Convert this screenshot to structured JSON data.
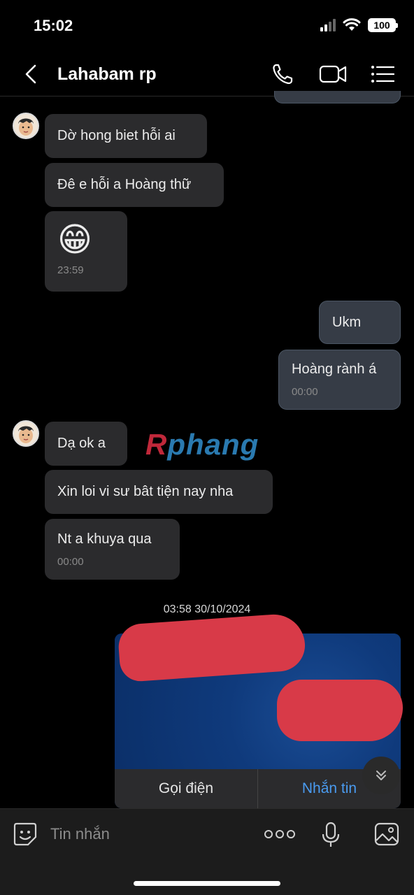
{
  "status": {
    "time": "15:02",
    "battery": "100"
  },
  "header": {
    "title": "Lahabam rp"
  },
  "messages": {
    "m1": "Dờ hong biet hỗi ai",
    "m2": "Đê e hỗi a Hoàng thữ",
    "m3_emoji": "😁",
    "m3_time": "23:59",
    "m4": "Ukm",
    "m5": "Hoàng rành á",
    "m5_time": "00:00",
    "m6": "Dạ ok a",
    "m7": "Xin loi vi sư bât tiện nay nha",
    "m8": "Nt a khuya qua",
    "m8_time": "00:00"
  },
  "watermark": {
    "r": "R",
    "rest": "phang"
  },
  "date_separator": "03:58 30/10/2024",
  "card": {
    "call_label": "Gọi điện",
    "message_label": "Nhắn tin"
  },
  "input": {
    "placeholder": "Tin nhắn"
  },
  "icons": {
    "back": "chevron-left-icon",
    "call": "phone-icon",
    "video": "video-camera-icon",
    "menu": "list-menu-icon",
    "sticker": "sticker-smile-icon",
    "more": "more-dots-icon",
    "mic": "microphone-icon",
    "image": "image-icon",
    "scroll": "double-chevron-down-icon"
  },
  "colors": {
    "accent": "#4a9bf0",
    "card_bg": "#0c3473",
    "redaction": "#d83a48"
  }
}
